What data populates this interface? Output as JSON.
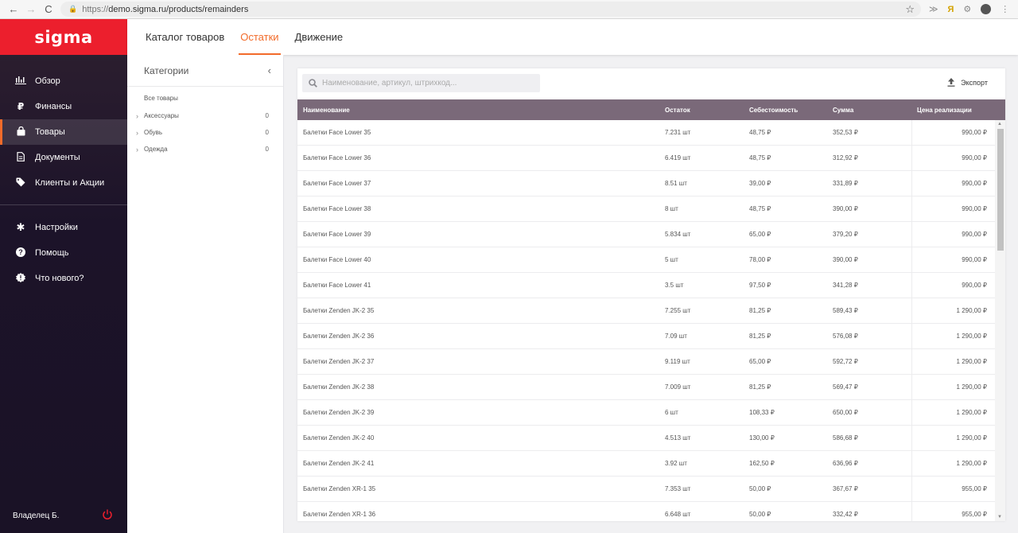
{
  "browser": {
    "url_scheme": "https://",
    "url_rest": "demo.sigma.ru/products/remainders"
  },
  "app": {
    "logo": "sigma",
    "brand_color": "#ec1f2d",
    "accent_color": "#f26b2a"
  },
  "sidebar": {
    "items": [
      {
        "label": "Обзор",
        "icon": "chart-icon"
      },
      {
        "label": "Финансы",
        "icon": "ruble-icon"
      },
      {
        "label": "Товары",
        "icon": "bag-icon",
        "active": true
      },
      {
        "label": "Документы",
        "icon": "document-icon"
      },
      {
        "label": "Клиенты и Акции",
        "icon": "tag-icon"
      }
    ],
    "bottom_items": [
      {
        "label": "Настройки",
        "icon": "gear-icon"
      },
      {
        "label": "Помощь",
        "icon": "help-icon"
      },
      {
        "label": "Что нового?",
        "icon": "news-icon"
      }
    ],
    "user": "Владелец Б."
  },
  "topnav": {
    "tabs": [
      "Каталог товаров",
      "Остатки",
      "Движение"
    ],
    "active": "Остатки"
  },
  "categories": {
    "title": "Категории",
    "all": "Все товары",
    "items": [
      {
        "label": "Аксессуары",
        "count": "0"
      },
      {
        "label": "Обувь",
        "count": "0"
      },
      {
        "label": "Одежда",
        "count": "0"
      }
    ]
  },
  "main": {
    "search_placeholder": "Наименование, артикул, штрихкод...",
    "export_label": "Экспорт",
    "columns": [
      "Наименование",
      "Остаток",
      "Себестоимость",
      "Сумма",
      "Цена реализации"
    ],
    "rows": [
      [
        "Балетки Face Lower 35",
        "7.231 шт",
        "48,75 ₽",
        "352,53 ₽",
        "990,00 ₽"
      ],
      [
        "Балетки Face Lower 36",
        "6.419 шт",
        "48,75 ₽",
        "312,92 ₽",
        "990,00 ₽"
      ],
      [
        "Балетки Face Lower 37",
        "8.51 шт",
        "39,00 ₽",
        "331,89 ₽",
        "990,00 ₽"
      ],
      [
        "Балетки Face Lower 38",
        "8 шт",
        "48,75 ₽",
        "390,00 ₽",
        "990,00 ₽"
      ],
      [
        "Балетки Face Lower 39",
        "5.834 шт",
        "65,00 ₽",
        "379,20 ₽",
        "990,00 ₽"
      ],
      [
        "Балетки Face Lower 40",
        "5 шт",
        "78,00 ₽",
        "390,00 ₽",
        "990,00 ₽"
      ],
      [
        "Балетки Face Lower 41",
        "3.5 шт",
        "97,50 ₽",
        "341,28 ₽",
        "990,00 ₽"
      ],
      [
        "Балетки Zenden JK-2 35",
        "7.255 шт",
        "81,25 ₽",
        "589,43 ₽",
        "1 290,00 ₽"
      ],
      [
        "Балетки Zenden JK-2 36",
        "7.09 шт",
        "81,25 ₽",
        "576,08 ₽",
        "1 290,00 ₽"
      ],
      [
        "Балетки Zenden JK-2 37",
        "9.119 шт",
        "65,00 ₽",
        "592,72 ₽",
        "1 290,00 ₽"
      ],
      [
        "Балетки Zenden JK-2 38",
        "7.009 шт",
        "81,25 ₽",
        "569,47 ₽",
        "1 290,00 ₽"
      ],
      [
        "Балетки Zenden JK-2 39",
        "6 шт",
        "108,33 ₽",
        "650,00 ₽",
        "1 290,00 ₽"
      ],
      [
        "Балетки Zenden JK-2 40",
        "4.513 шт",
        "130,00 ₽",
        "586,68 ₽",
        "1 290,00 ₽"
      ],
      [
        "Балетки Zenden JK-2 41",
        "3.92 шт",
        "162,50 ₽",
        "636,96 ₽",
        "1 290,00 ₽"
      ],
      [
        "Балетки Zenden XR-1 35",
        "7.353 шт",
        "50,00 ₽",
        "367,67 ₽",
        "955,00 ₽"
      ],
      [
        "Балетки Zenden XR-1 36",
        "6.648 шт",
        "50,00 ₽",
        "332,42 ₽",
        "955,00 ₽"
      ]
    ]
  }
}
